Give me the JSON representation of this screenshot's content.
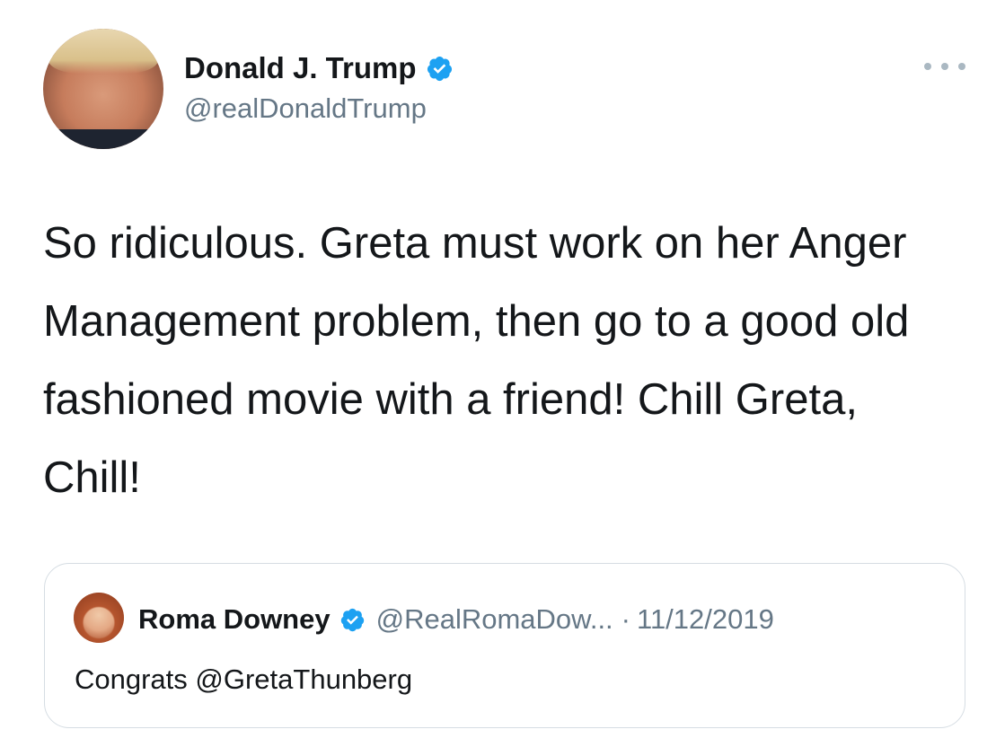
{
  "tweet": {
    "author": {
      "display_name": "Donald J. Trump",
      "handle": "@realDonaldTrump",
      "verified": true,
      "avatar": "profile-photo"
    },
    "more_icon": "more-horizontal-icon",
    "text": "So ridiculous. Greta must work on her Anger Management problem, then go to a good old fashioned movie with a friend! Chill Greta, Chill!"
  },
  "quoted_tweet": {
    "author": {
      "display_name": "Roma Downey",
      "handle": "@RealRomaDow...",
      "verified": true,
      "avatar": "profile-photo"
    },
    "separator": "·",
    "date": "11/12/2019",
    "text": "Congrats @GretaThunberg"
  },
  "colors": {
    "verified_blue": "#1da1f2",
    "text_primary": "#14171a",
    "text_secondary": "#657786",
    "border": "#d6dde3",
    "background": "#ffffff"
  }
}
